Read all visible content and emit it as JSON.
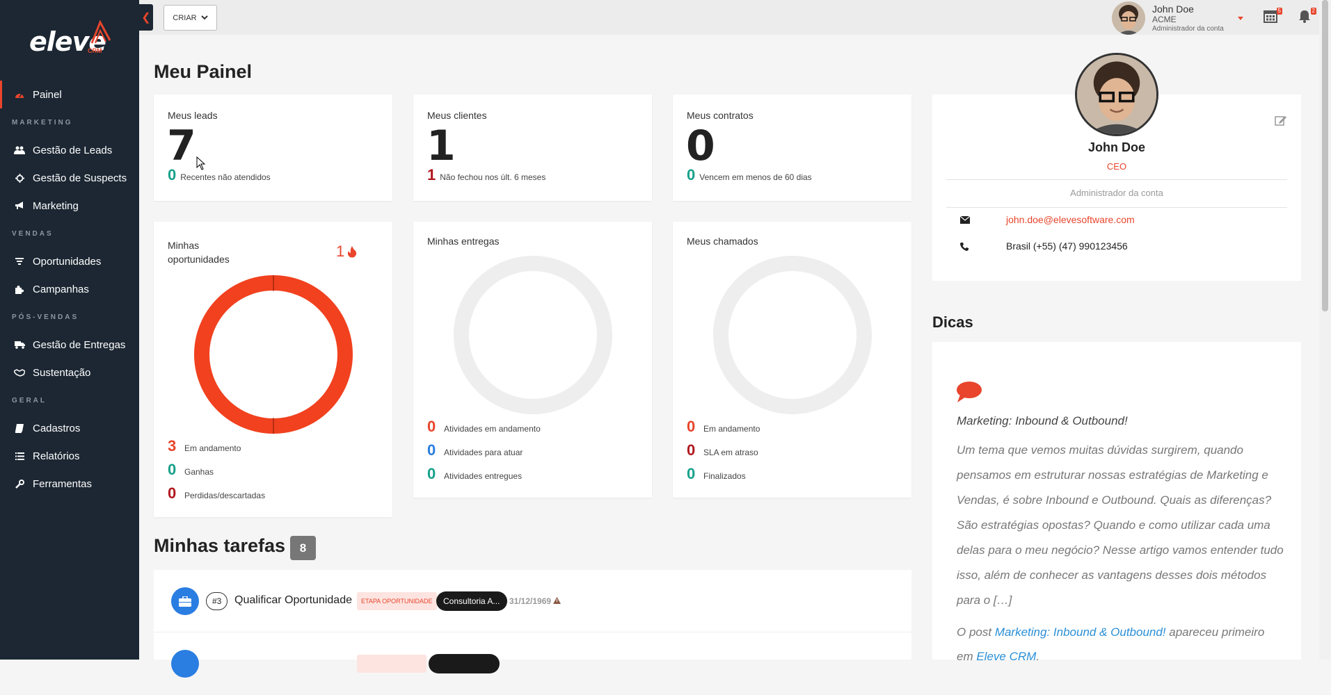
{
  "brand": {
    "logo_text": "eleve",
    "logo_sub": "CRM",
    "accent": "#e8452c",
    "sidebar_bg": "#1c2733"
  },
  "sidebar": {
    "items": [
      {
        "label": "Painel",
        "icon": "dashboard-icon",
        "active": true
      },
      {
        "label": "Gestão de Leads",
        "icon": "users-icon"
      },
      {
        "label": "Gestão de Suspects",
        "icon": "crosshair-icon"
      },
      {
        "label": "Marketing",
        "icon": "megaphone-icon"
      },
      {
        "label": "Oportunidades",
        "icon": "filter-icon"
      },
      {
        "label": "Campanhas",
        "icon": "puzzle-icon"
      },
      {
        "label": "Gestão de Entregas",
        "icon": "truck-icon"
      },
      {
        "label": "Sustentação",
        "icon": "handshake-icon"
      },
      {
        "label": "Cadastros",
        "icon": "book-icon"
      },
      {
        "label": "Relatórios",
        "icon": "list-icon"
      },
      {
        "label": "Ferramentas",
        "icon": "wrench-icon"
      }
    ],
    "sections": [
      "MARKETING",
      "VENDAS",
      "PÓS-VENDAS",
      "GERAL"
    ]
  },
  "topbar": {
    "create_label": "CRIAR",
    "user": {
      "name": "John Doe",
      "company": "ACME",
      "role": "Administrador da conta"
    },
    "calendar_badge": "5",
    "notifications_badge": "2"
  },
  "main": {
    "title": "Meu Painel",
    "cards": {
      "leads": {
        "title": "Meus leads",
        "value": "7",
        "sub_value": "0",
        "sub_label": "Recentes não atendidos"
      },
      "clientes": {
        "title": "Meus clientes",
        "value": "1",
        "sub_value": "1",
        "sub_label": "Não fechou nos últ. 6 meses"
      },
      "contratos": {
        "title": "Meus contratos",
        "value": "0",
        "sub_value": "0",
        "sub_label": "Vencem em menos de 60 dias"
      }
    },
    "oportunidades": {
      "title_line1": "Minhas",
      "title_line2": "oportunidades",
      "hot_count": "1",
      "stats": [
        {
          "value": "3",
          "label": "Em andamento"
        },
        {
          "value": "0",
          "label": "Ganhas"
        },
        {
          "value": "0",
          "label": "Perdidas/descartadas"
        }
      ]
    },
    "entregas": {
      "title": "Minhas entregas",
      "stats": [
        {
          "value": "0",
          "label": "Atividades em andamento"
        },
        {
          "value": "0",
          "label": "Atividades para atuar"
        },
        {
          "value": "0",
          "label": "Atividades entregues"
        }
      ]
    },
    "chamados": {
      "title": "Meus chamados",
      "stats": [
        {
          "value": "0",
          "label": "Em andamento"
        },
        {
          "value": "0",
          "label": "SLA em atraso"
        },
        {
          "value": "0",
          "label": "Finalizados"
        }
      ]
    },
    "tasks": {
      "title": "Minhas tarefas",
      "count": "8",
      "rows": [
        {
          "num": "#3",
          "name": "Qualificar Oportunidade",
          "stage": "ETAPA OPORTUNIDADE",
          "chip": "Consultoria A...",
          "date": "31/12/1969"
        }
      ]
    }
  },
  "profile": {
    "name": "John Doe",
    "role": "CEO",
    "account_role": "Administrador da conta",
    "email": "john.doe@elevesoftware.com",
    "phone": "Brasil (+55) (47) 990123456"
  },
  "dicas": {
    "title": "Dicas",
    "post_title": "Marketing: Inbound & Outbound!",
    "body": "Um tema que vemos muitas dúvidas surgirem, quando pensamos em estruturar nossas estratégias de Marketing e Vendas, é sobre Inbound e Outbound. Quais as diferenças? São estratégias opostas? Quando e como utilizar cada uma delas para o meu negócio? Nesse artigo vamos entender tudo isso, além de conhecer as vantagens desses dois métodos para o […]",
    "footer_prefix": "O post ",
    "footer_link": "Marketing: Inbound & Outbound!",
    "footer_mid": " apareceu primeiro em ",
    "footer_site": "Eleve CRM",
    "footer_end": "."
  }
}
